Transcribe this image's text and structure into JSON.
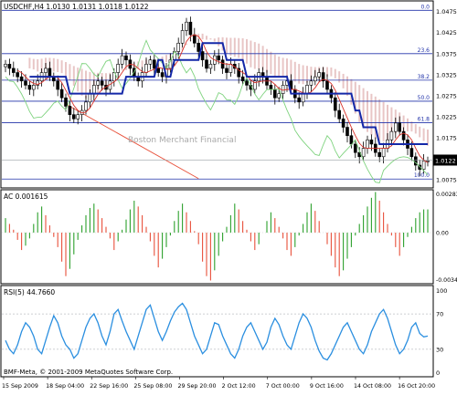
{
  "chart_data": [
    {
      "type": "candlestick",
      "panel": "main",
      "symbol_header": "USDCHF,H4  1.0130 1.0131 1.0118 1.0122",
      "watermark": "Boston Merchant Financial",
      "ylim": [
        1.0058,
        1.0496
      ],
      "y_ticks": [
        "1.0475",
        "1.0425",
        "1.0375",
        "1.0325",
        "1.0275",
        "1.0225",
        "1.0175",
        "1.0075"
      ],
      "current_price": "1.0122",
      "fib_levels": [
        {
          "label": "0.0",
          "value": 1.0478
        },
        {
          "label": "23.6",
          "value": 1.0375
        },
        {
          "label": "38.2",
          "value": 1.0312
        },
        {
          "label": "50.0",
          "value": 1.0262
        },
        {
          "label": "61.8",
          "value": 1.0211
        },
        {
          "label": "100.0",
          "value": 1.0077
        }
      ],
      "close_series": [
        1.035,
        1.034,
        1.033,
        1.032,
        1.031,
        1.03,
        1.029,
        1.03,
        1.031,
        1.033,
        1.034,
        1.032,
        1.031,
        1.029,
        1.027,
        1.025,
        1.023,
        1.022,
        1.023,
        1.024,
        1.026,
        1.028,
        1.03,
        1.031,
        1.03,
        1.029,
        1.031,
        1.033,
        1.035,
        1.037,
        1.036,
        1.034,
        1.032,
        1.031,
        1.033,
        1.035,
        1.036,
        1.034,
        1.033,
        1.032,
        1.034,
        1.036,
        1.038,
        1.04,
        1.043,
        1.045,
        1.042,
        1.04,
        1.038,
        1.036,
        1.034,
        1.035,
        1.037,
        1.036,
        1.034,
        1.033,
        1.035,
        1.034,
        1.032,
        1.031,
        1.03,
        1.029,
        1.031,
        1.033,
        1.032,
        1.03,
        1.029,
        1.027,
        1.028,
        1.03,
        1.031,
        1.029,
        1.027,
        1.026,
        1.028,
        1.03,
        1.031,
        1.032,
        1.033,
        1.031,
        1.029,
        1.027,
        1.024,
        1.022,
        1.02,
        1.018,
        1.016,
        1.014,
        1.013,
        1.015,
        1.017,
        1.016,
        1.014,
        1.013,
        1.015,
        1.017,
        1.019,
        1.021,
        1.019,
        1.017,
        1.015,
        1.013,
        1.011,
        1.01,
        1.012,
        1.012
      ]
    },
    {
      "type": "bar",
      "panel": "ac",
      "label": "AC 0.001615",
      "ylim": [
        -0.00346,
        0.00283
      ],
      "y_ticks": [
        "0.002836",
        "0.00",
        "-0.0034E"
      ],
      "colors": {
        "up": "#2ca02c",
        "down": "#e8503a"
      },
      "values": [
        0.001,
        0.0006,
        0.0002,
        -0.0005,
        -0.0012,
        -0.0009,
        -0.0004,
        0.0006,
        0.0014,
        0.0018,
        0.0012,
        0.0005,
        -0.0003,
        -0.001,
        -0.002,
        -0.003,
        -0.0025,
        -0.0015,
        -0.0005,
        0.0005,
        0.0012,
        0.0017,
        0.002,
        0.0016,
        0.001,
        0.0004,
        -0.0004,
        -0.0012,
        -0.0006,
        0.0002,
        0.0009,
        0.0016,
        0.0022,
        0.0018,
        0.0012,
        0.0004,
        -0.0006,
        -0.0016,
        -0.0024,
        -0.0018,
        -0.001,
        -0.0002,
        0.0008,
        0.0015,
        0.002,
        0.0014,
        0.0008,
        0.0001,
        -0.0008,
        -0.002,
        -0.003,
        -0.0033,
        -0.0026,
        -0.0016,
        -0.0006,
        0.0004,
        0.0012,
        0.002,
        0.0016,
        0.0008,
        0.0002,
        -0.0006,
        -0.0012,
        -0.0008,
        0.0,
        0.0008,
        0.0014,
        0.001,
        0.0004,
        -0.0004,
        -0.0012,
        -0.0016,
        -0.001,
        -0.0002,
        0.0006,
        0.0014,
        0.002,
        0.0015,
        0.0008,
        0.0,
        -0.0008,
        -0.0016,
        -0.0024,
        -0.003,
        -0.0026,
        -0.0018,
        -0.001,
        -0.0002,
        0.0006,
        0.0012,
        0.0018,
        0.0024,
        0.0028,
        0.0022,
        0.0014,
        0.0006,
        -0.0002,
        -0.001,
        -0.0016,
        -0.001,
        -0.0003,
        0.0004,
        0.001,
        0.0014,
        0.0016,
        0.0016
      ]
    },
    {
      "type": "line",
      "panel": "rsi",
      "label": "RSI(5) 44.7660",
      "ylim": [
        0,
        100
      ],
      "y_ticks": [
        "100",
        "70",
        "30",
        "0"
      ],
      "levels": [
        70,
        30
      ],
      "color": "#2b8fe0",
      "values": [
        40,
        30,
        25,
        35,
        50,
        60,
        55,
        45,
        30,
        25,
        40,
        55,
        68,
        60,
        45,
        35,
        30,
        20,
        25,
        40,
        55,
        65,
        70,
        60,
        45,
        35,
        50,
        70,
        75,
        62,
        50,
        40,
        30,
        45,
        60,
        75,
        80,
        65,
        50,
        40,
        50,
        62,
        72,
        78,
        82,
        75,
        60,
        45,
        35,
        25,
        30,
        45,
        60,
        58,
        45,
        35,
        25,
        20,
        30,
        45,
        55,
        60,
        50,
        40,
        30,
        38,
        55,
        65,
        58,
        45,
        35,
        30,
        45,
        60,
        70,
        65,
        55,
        40,
        28,
        20,
        18,
        25,
        35,
        45,
        55,
        60,
        50,
        40,
        30,
        25,
        35,
        50,
        60,
        70,
        75,
        65,
        50,
        35,
        25,
        30,
        40,
        55,
        60,
        48,
        44,
        45
      ]
    }
  ],
  "x_axis": {
    "labels": [
      "15 Sep 2009",
      "18 Sep 04:00",
      "22 Sep 16:00",
      "25 Sep 08:00",
      "29 Sep 20:00",
      "2 Oct 12:00",
      "7 Oct 00:00",
      "9 Oct 16:00",
      "14 Oct 08:00",
      "16 Oct 20:00"
    ]
  },
  "copyright": "BMF-Meta, © 2001-2009 MetaQuotes Software Corp."
}
